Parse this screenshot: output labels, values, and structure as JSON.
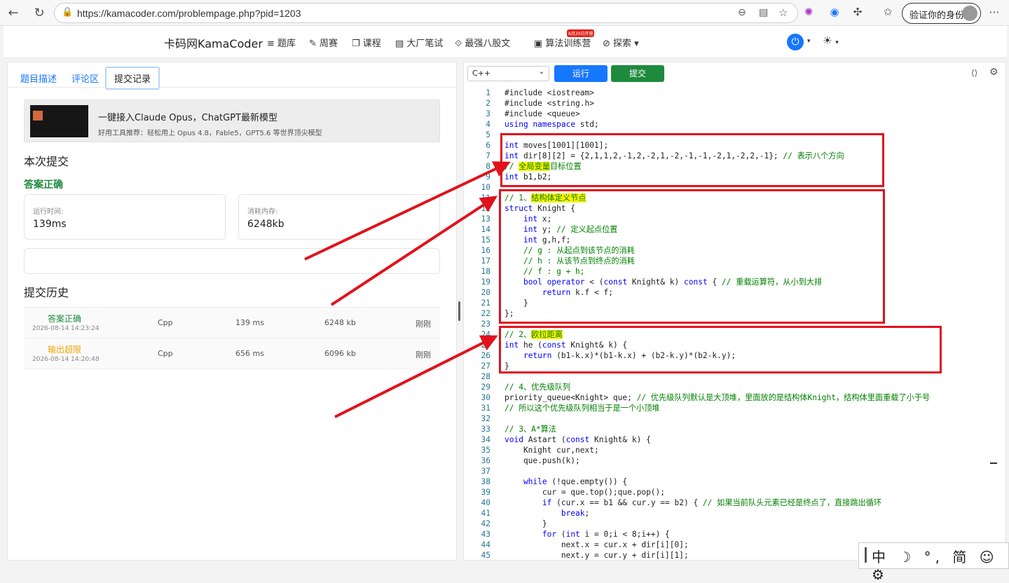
{
  "browser": {
    "url": "https://kamacoder.com/problempage.php?pid=1203",
    "verify_label": "验证你的身份"
  },
  "header": {
    "logo": "卡码网KamaCoder",
    "menu": [
      "题库",
      "周赛",
      "课程",
      "大厂笔试",
      "最强八股文",
      "算法训练营",
      "探索"
    ],
    "badge": "8月20日开营"
  },
  "left": {
    "tabs": [
      "题目描述",
      "评论区",
      "提交记录"
    ],
    "ad_title": "一键接入Claude Opus，ChatGPT最新模型",
    "ad_sub": "好用工具推荐：轻松用上 Opus 4.8，Fable5，GPT5.6 等世界顶尖模型",
    "section_submit": "本次提交",
    "result": "答案正确",
    "run_time_label": "运行时间:",
    "run_time": "139ms",
    "memory_label": "消耗内存:",
    "memory": "6248kb",
    "section_history": "提交历史",
    "history": [
      {
        "status": "答案正确",
        "time": "2026-08-14 14:23:24",
        "lang": "Cpp",
        "runtime": "139 ms",
        "mem": "6248 kb",
        "when": "刚刚",
        "color": "#1e8a3e"
      },
      {
        "status": "输出超限",
        "time": "2026-08-14 14:20:48",
        "lang": "Cpp",
        "runtime": "656 ms",
        "mem": "6096 kb",
        "when": "刚刚",
        "color": "#f0a500"
      }
    ]
  },
  "editor": {
    "language": "C++",
    "run_label": "运行",
    "submit_label": "提交",
    "lines": [
      "#include <iostream>",
      "#include <string.h>",
      "#include <queue>",
      "using namespace std;",
      "",
      "int moves[1001][1001];",
      "int dir[8][2] = {2,1,1,2,-1,2,-2,1,-2,-1,-1,-2,1,-2,2,-1}; // 表示八个方向",
      "// 全局变量目标位置",
      "int b1,b2;",
      "",
      "// 1、结构体定义节点",
      "struct Knight {",
      "    int x;",
      "    int y; // 定义起点位置",
      "    int g,h,f;",
      "    // g : 从起点到该节点的消耗",
      "    // h : 从该节点到终点的消耗",
      "    // f : g + h;",
      "    bool operator < (const Knight& k) const { // 重载运算符，从小到大排",
      "        return k.f < f;",
      "    }",
      "};",
      "",
      "// 2、欧拉距离",
      "int he (const Knight& k) {",
      "    return (b1-k.x)*(b1-k.x) + (b2-k.y)*(b2-k.y);",
      "}",
      "",
      "// 4、优先级队列",
      "priority_queue<Knight> que; // 优先级队列默认是大顶堆，里面放的是结构体Knight，结构体里面重载了小于号",
      "// 所以这个优先级队列相当于是一个小顶堆",
      "",
      "// 3、A*算法",
      "void Astart (const Knight& k) {",
      "    Knight cur,next;",
      "    que.push(k);",
      "",
      "    while (!que.empty()) {",
      "        cur = que.top();que.pop();",
      "        if (cur.x == b1 && cur.y == b2) { // 如果当前队头元素已经是终点了，直接跳出循环",
      "            break;",
      "        }",
      "        for (int i = 0;i < 8;i++) {",
      "            next.x = cur.x + dir[i][0];",
      "            next.y = cur.y + dir[i][1];"
    ]
  },
  "ime": {
    "text": "中 ☽ °, 简 ☺ ⚙"
  },
  "colors": {
    "accent": "#1677ff",
    "success": "#1e8a3e",
    "warn": "#f0a500",
    "annotation": "#e1121c"
  }
}
